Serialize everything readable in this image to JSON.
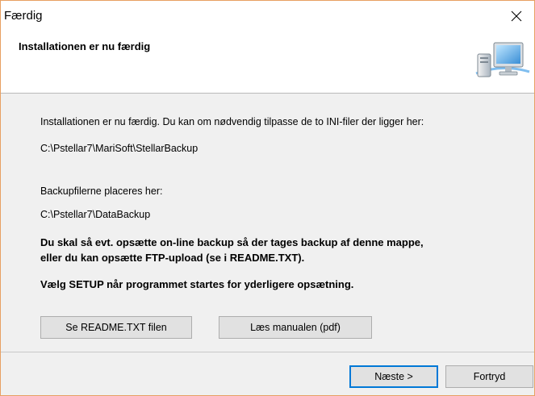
{
  "window": {
    "title": "Færdig"
  },
  "header": {
    "title": "Installationen er nu færdig",
    "icon": "computer-icon"
  },
  "content": {
    "intro": "Installationen er nu færdig.  Du kan om nødvendig tilpasse de to INI-filer der ligger her:",
    "ini_path": "C:\\Pstellar7\\MariSoft\\StellarBackup",
    "backup_label": "Backupfilerne placeres her:",
    "backup_path": "C:\\Pstellar7\\DataBackup",
    "notice_line1": "Du skal så evt. opsætte on-line backup så der tages backup af denne mappe,",
    "notice_line2": "eller du kan opsætte FTP-upload (se i README.TXT).",
    "setup_hint": "Vælg SETUP når programmet startes for yderligere opsætning."
  },
  "buttons": {
    "readme": "Se README.TXT filen",
    "manual": "Læs manualen (pdf)",
    "next": "Næste >",
    "cancel": "Fortryd"
  },
  "colors": {
    "window_border": "#e8a062",
    "focus_border": "#0078d7",
    "button_face": "#e1e1e1",
    "dialog_background": "#f0f0f0"
  }
}
